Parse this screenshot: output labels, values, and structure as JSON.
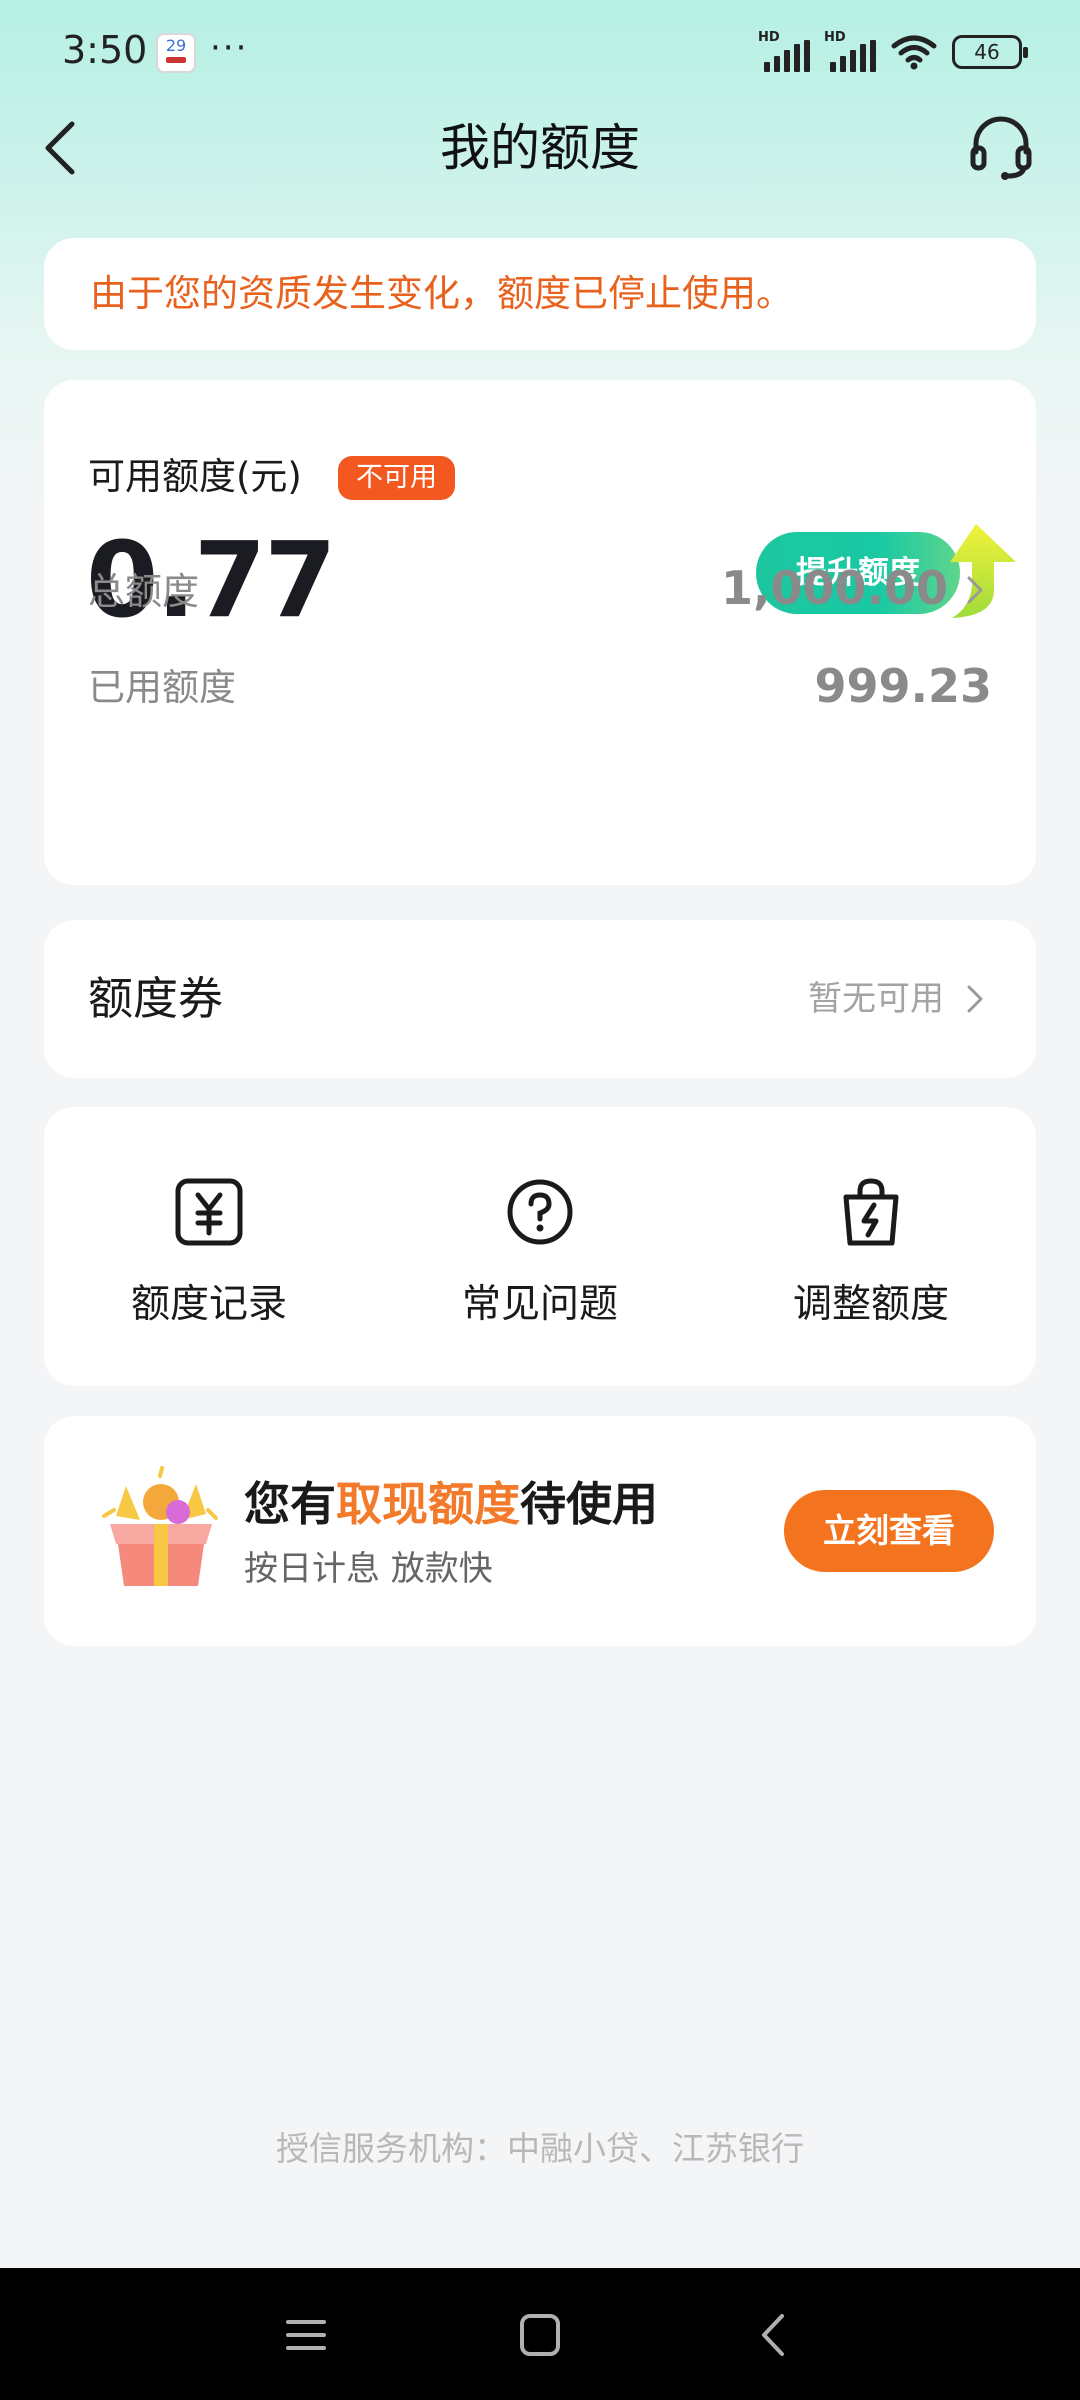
{
  "status_bar": {
    "time": "3:50",
    "calendar_day": "29",
    "more": "···",
    "network_1": "HD",
    "network_2": "HD",
    "battery": "46"
  },
  "nav": {
    "title": "我的额度",
    "back_icon": "chevron-left-icon",
    "support_icon": "headset-icon"
  },
  "notice": {
    "text": "由于您的资质发生变化，额度已停止使用。"
  },
  "credit": {
    "available_label": "可用额度(元)",
    "status_badge": "不可用",
    "available_amount": "0.77",
    "raise_button": "提升额度",
    "total_label": "总额度",
    "total_value": "1,000.00",
    "used_label": "已用额度",
    "used_value": "999.23"
  },
  "coupon": {
    "title": "额度券",
    "status": "暂无可用"
  },
  "actions": [
    {
      "label": "额度记录",
      "icon": "yen-receipt-icon"
    },
    {
      "label": "常见问题",
      "icon": "question-circle-icon"
    },
    {
      "label": "调整额度",
      "icon": "lightning-bag-icon"
    }
  ],
  "promo": {
    "title_prefix": "您有",
    "title_highlight": "取现额度",
    "title_suffix": "待使用",
    "subtitle": "按日计息 放款快",
    "button": "立刻查看",
    "icon": "gift-box-icon"
  },
  "footer": {
    "text": "授信服务机构：中融小贷、江苏银行"
  },
  "colors": {
    "accent_orange": "#f4731f",
    "notice_orange": "#e8621e",
    "badge_red": "#f2581f",
    "teal": "#1cc7a0"
  }
}
